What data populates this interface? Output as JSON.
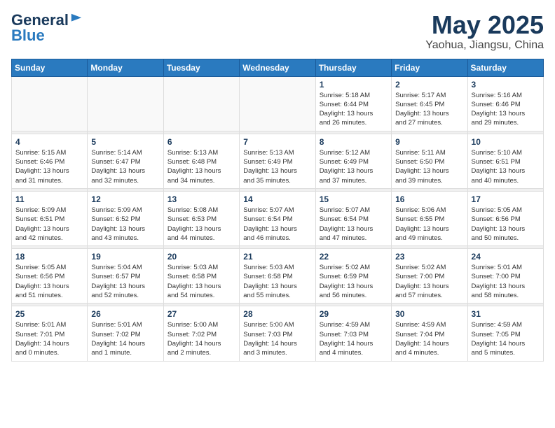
{
  "header": {
    "logo": {
      "general": "General",
      "blue": "Blue"
    },
    "title": "May 2025",
    "subtitle": "Yaohua, Jiangsu, China"
  },
  "calendar": {
    "weekdays": [
      "Sunday",
      "Monday",
      "Tuesday",
      "Wednesday",
      "Thursday",
      "Friday",
      "Saturday"
    ],
    "weeks": [
      [
        {
          "day": "",
          "info": ""
        },
        {
          "day": "",
          "info": ""
        },
        {
          "day": "",
          "info": ""
        },
        {
          "day": "",
          "info": ""
        },
        {
          "day": "1",
          "info": "Sunrise: 5:18 AM\nSunset: 6:44 PM\nDaylight: 13 hours\nand 26 minutes."
        },
        {
          "day": "2",
          "info": "Sunrise: 5:17 AM\nSunset: 6:45 PM\nDaylight: 13 hours\nand 27 minutes."
        },
        {
          "day": "3",
          "info": "Sunrise: 5:16 AM\nSunset: 6:46 PM\nDaylight: 13 hours\nand 29 minutes."
        }
      ],
      [
        {
          "day": "4",
          "info": "Sunrise: 5:15 AM\nSunset: 6:46 PM\nDaylight: 13 hours\nand 31 minutes."
        },
        {
          "day": "5",
          "info": "Sunrise: 5:14 AM\nSunset: 6:47 PM\nDaylight: 13 hours\nand 32 minutes."
        },
        {
          "day": "6",
          "info": "Sunrise: 5:13 AM\nSunset: 6:48 PM\nDaylight: 13 hours\nand 34 minutes."
        },
        {
          "day": "7",
          "info": "Sunrise: 5:13 AM\nSunset: 6:49 PM\nDaylight: 13 hours\nand 35 minutes."
        },
        {
          "day": "8",
          "info": "Sunrise: 5:12 AM\nSunset: 6:49 PM\nDaylight: 13 hours\nand 37 minutes."
        },
        {
          "day": "9",
          "info": "Sunrise: 5:11 AM\nSunset: 6:50 PM\nDaylight: 13 hours\nand 39 minutes."
        },
        {
          "day": "10",
          "info": "Sunrise: 5:10 AM\nSunset: 6:51 PM\nDaylight: 13 hours\nand 40 minutes."
        }
      ],
      [
        {
          "day": "11",
          "info": "Sunrise: 5:09 AM\nSunset: 6:51 PM\nDaylight: 13 hours\nand 42 minutes."
        },
        {
          "day": "12",
          "info": "Sunrise: 5:09 AM\nSunset: 6:52 PM\nDaylight: 13 hours\nand 43 minutes."
        },
        {
          "day": "13",
          "info": "Sunrise: 5:08 AM\nSunset: 6:53 PM\nDaylight: 13 hours\nand 44 minutes."
        },
        {
          "day": "14",
          "info": "Sunrise: 5:07 AM\nSunset: 6:54 PM\nDaylight: 13 hours\nand 46 minutes."
        },
        {
          "day": "15",
          "info": "Sunrise: 5:07 AM\nSunset: 6:54 PM\nDaylight: 13 hours\nand 47 minutes."
        },
        {
          "day": "16",
          "info": "Sunrise: 5:06 AM\nSunset: 6:55 PM\nDaylight: 13 hours\nand 49 minutes."
        },
        {
          "day": "17",
          "info": "Sunrise: 5:05 AM\nSunset: 6:56 PM\nDaylight: 13 hours\nand 50 minutes."
        }
      ],
      [
        {
          "day": "18",
          "info": "Sunrise: 5:05 AM\nSunset: 6:56 PM\nDaylight: 13 hours\nand 51 minutes."
        },
        {
          "day": "19",
          "info": "Sunrise: 5:04 AM\nSunset: 6:57 PM\nDaylight: 13 hours\nand 52 minutes."
        },
        {
          "day": "20",
          "info": "Sunrise: 5:03 AM\nSunset: 6:58 PM\nDaylight: 13 hours\nand 54 minutes."
        },
        {
          "day": "21",
          "info": "Sunrise: 5:03 AM\nSunset: 6:58 PM\nDaylight: 13 hours\nand 55 minutes."
        },
        {
          "day": "22",
          "info": "Sunrise: 5:02 AM\nSunset: 6:59 PM\nDaylight: 13 hours\nand 56 minutes."
        },
        {
          "day": "23",
          "info": "Sunrise: 5:02 AM\nSunset: 7:00 PM\nDaylight: 13 hours\nand 57 minutes."
        },
        {
          "day": "24",
          "info": "Sunrise: 5:01 AM\nSunset: 7:00 PM\nDaylight: 13 hours\nand 58 minutes."
        }
      ],
      [
        {
          "day": "25",
          "info": "Sunrise: 5:01 AM\nSunset: 7:01 PM\nDaylight: 14 hours\nand 0 minutes."
        },
        {
          "day": "26",
          "info": "Sunrise: 5:01 AM\nSunset: 7:02 PM\nDaylight: 14 hours\nand 1 minute."
        },
        {
          "day": "27",
          "info": "Sunrise: 5:00 AM\nSunset: 7:02 PM\nDaylight: 14 hours\nand 2 minutes."
        },
        {
          "day": "28",
          "info": "Sunrise: 5:00 AM\nSunset: 7:03 PM\nDaylight: 14 hours\nand 3 minutes."
        },
        {
          "day": "29",
          "info": "Sunrise: 4:59 AM\nSunset: 7:03 PM\nDaylight: 14 hours\nand 4 minutes."
        },
        {
          "day": "30",
          "info": "Sunrise: 4:59 AM\nSunset: 7:04 PM\nDaylight: 14 hours\nand 4 minutes."
        },
        {
          "day": "31",
          "info": "Sunrise: 4:59 AM\nSunset: 7:05 PM\nDaylight: 14 hours\nand 5 minutes."
        }
      ]
    ]
  }
}
